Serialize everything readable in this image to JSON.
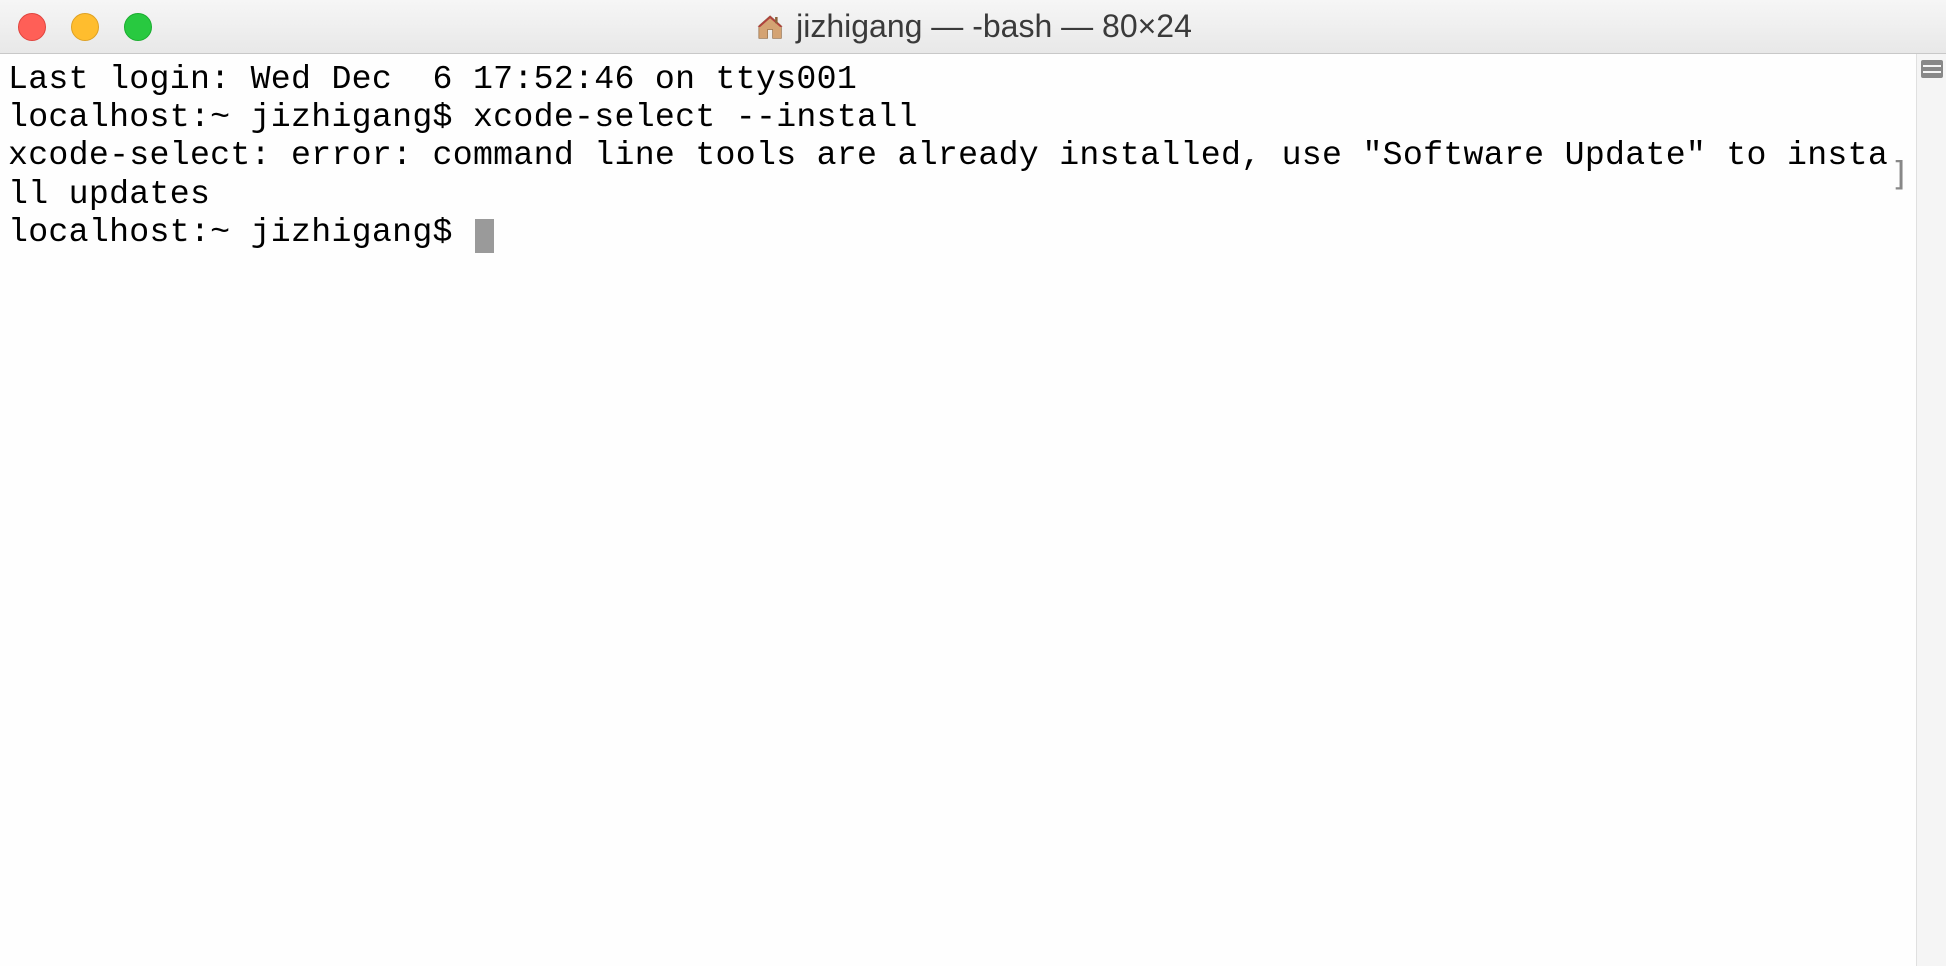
{
  "titlebar": {
    "title": "jizhigang — -bash — 80×24",
    "home_icon": "home-icon"
  },
  "terminal": {
    "lines": [
      "Last login: Wed Dec  6 17:52:46 on ttys001",
      "localhost:~ jizhigang$ xcode-select --install",
      "xcode-select: error: command line tools are already installed, use \"Software Update\" to install updates"
    ],
    "prompt": "localhost:~ jizhigang$ ",
    "bracket": "]"
  }
}
